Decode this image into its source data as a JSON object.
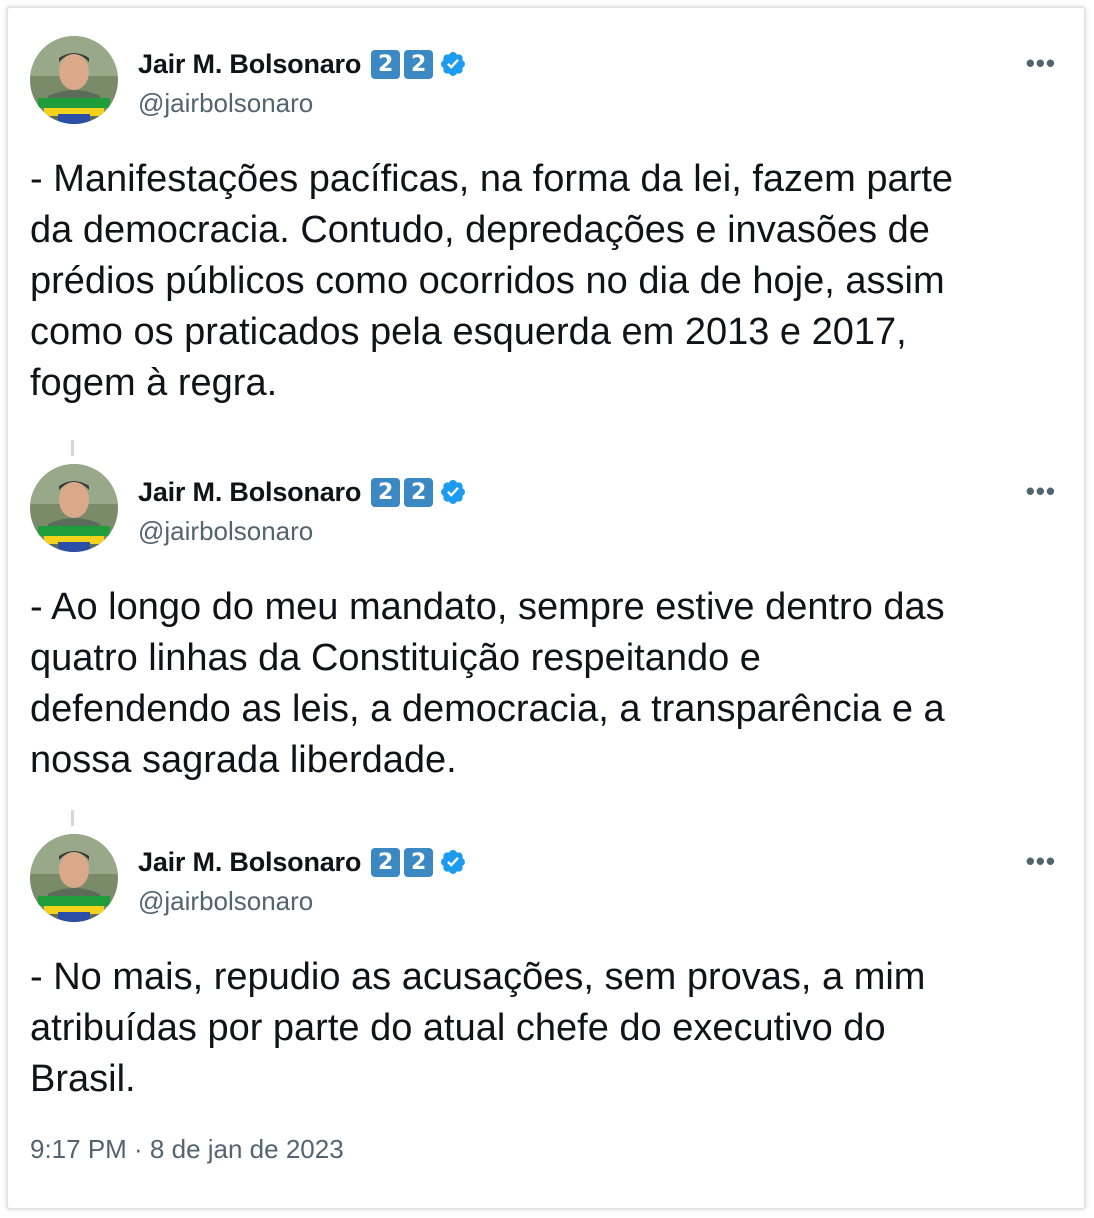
{
  "tweets": [
    {
      "display_name": "Jair M. Bolsonaro",
      "badges": [
        "2",
        "2"
      ],
      "verified_icon": "verified-badge-icon",
      "handle": "@jairbolsonaro",
      "more": "•••",
      "text": "- Manifestações pacíficas, na forma da lei, fazem parte\nda democracia. Contudo, depredações e invasões de\nprédios públicos como ocorridos no dia de hoje, assim\ncomo os praticados pela esquerda em 2013 e 2017,\nfogem à regra."
    },
    {
      "display_name": "Jair M. Bolsonaro",
      "badges": [
        "2",
        "2"
      ],
      "verified_icon": "verified-badge-icon",
      "handle": "@jairbolsonaro",
      "more": "•••",
      "text": "- Ao longo do meu mandato, sempre estive dentro das\nquatro linhas da Constituição respeitando e\ndefendendo as leis, a democracia, a transparência e a\nnossa sagrada liberdade."
    },
    {
      "display_name": "Jair M. Bolsonaro",
      "badges": [
        "2",
        "2"
      ],
      "verified_icon": "verified-badge-icon",
      "handle": "@jairbolsonaro",
      "more": "•••",
      "text": "- No mais, repudio as acusações, sem provas, a mim\natribuídas por parte do atual chefe do executivo do\nBrasil."
    }
  ],
  "timestamp": "9:17 PM · 8 de jan de 2023",
  "colors": {
    "verified_blue": "#1d9bf0",
    "badge_blue": "#3b88c3",
    "secondary_text": "#536471",
    "primary_text": "#0f1419"
  }
}
